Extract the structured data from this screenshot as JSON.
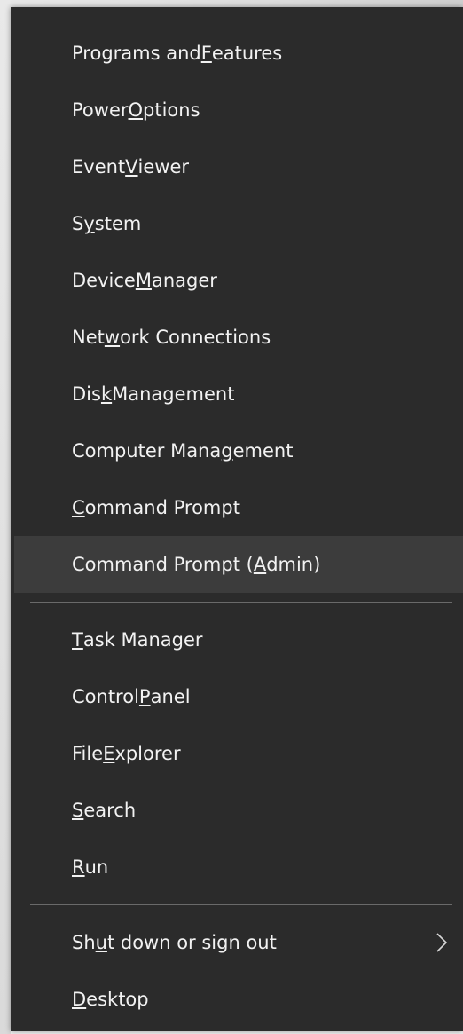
{
  "menu": {
    "group1": [
      {
        "pre": "Programs and ",
        "key": "F",
        "post": "eatures"
      },
      {
        "pre": "Power ",
        "key": "O",
        "post": "ptions"
      },
      {
        "pre": "Event ",
        "key": "V",
        "post": "iewer"
      },
      {
        "pre": "S",
        "key": "y",
        "post": "stem"
      },
      {
        "pre": "Device ",
        "key": "M",
        "post": "anager"
      },
      {
        "pre": "Net",
        "key": "w",
        "post": "ork Connections"
      },
      {
        "pre": "Dis",
        "key": "k",
        "post": " Management"
      },
      {
        "pre": "Computer Mana",
        "key": "g",
        "post": "ement"
      },
      {
        "pre": "",
        "key": "C",
        "post": "ommand Prompt"
      },
      {
        "pre": "Command Prompt (",
        "key": "A",
        "post": "dmin)"
      }
    ],
    "group2": [
      {
        "pre": "",
        "key": "T",
        "post": "ask Manager"
      },
      {
        "pre": "Control ",
        "key": "P",
        "post": "anel"
      },
      {
        "pre": "File ",
        "key": "E",
        "post": "xplorer"
      },
      {
        "pre": "",
        "key": "S",
        "post": "earch"
      },
      {
        "pre": "",
        "key": "R",
        "post": "un"
      }
    ],
    "group3": [
      {
        "pre": "Sh",
        "key": "u",
        "post": "t down or sign out"
      },
      {
        "pre": "",
        "key": "D",
        "post": "esktop"
      }
    ],
    "highlighted_index": 9,
    "colors": {
      "background": "#2b2b2b",
      "highlight": "#3c3c3c",
      "text": "#f2f2f2",
      "separator": "#6a6a6a"
    },
    "submenu_icon": "chevron-right-icon"
  }
}
